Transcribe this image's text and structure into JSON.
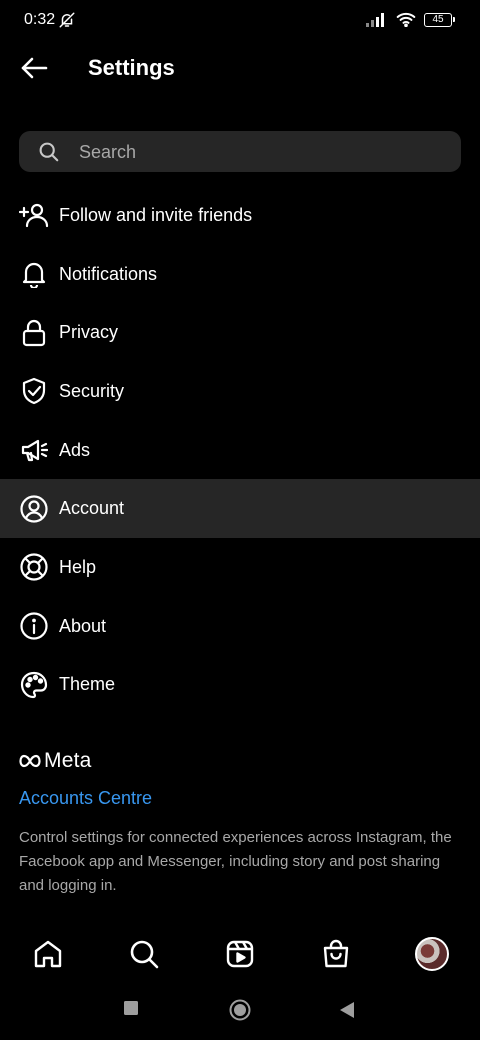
{
  "status_bar": {
    "time": "0:32",
    "battery": "45"
  },
  "header": {
    "title": "Settings"
  },
  "search": {
    "placeholder": "Search"
  },
  "menu": {
    "items": [
      {
        "label": "Follow and invite friends",
        "icon": "add-person-icon"
      },
      {
        "label": "Notifications",
        "icon": "bell-icon"
      },
      {
        "label": "Privacy",
        "icon": "lock-icon"
      },
      {
        "label": "Security",
        "icon": "shield-icon"
      },
      {
        "label": "Ads",
        "icon": "megaphone-icon"
      },
      {
        "label": "Account",
        "icon": "person-circle-icon",
        "highlighted": true
      },
      {
        "label": "Help",
        "icon": "lifebuoy-icon"
      },
      {
        "label": "About",
        "icon": "info-icon"
      },
      {
        "label": "Theme",
        "icon": "palette-icon"
      }
    ]
  },
  "meta": {
    "logo_text": "Meta",
    "accounts_centre": "Accounts Centre",
    "description": "Control settings for connected experiences across Instagram, the Facebook app and Messenger, including story and post sharing and logging in."
  },
  "bottom_nav": {
    "items": [
      "home-icon",
      "search-icon",
      "reels-icon",
      "shop-icon",
      "profile-avatar"
    ]
  },
  "colors": {
    "background": "#000000",
    "highlight": "#262626",
    "link": "#3897f0",
    "secondary_text": "#a8a8a8"
  }
}
